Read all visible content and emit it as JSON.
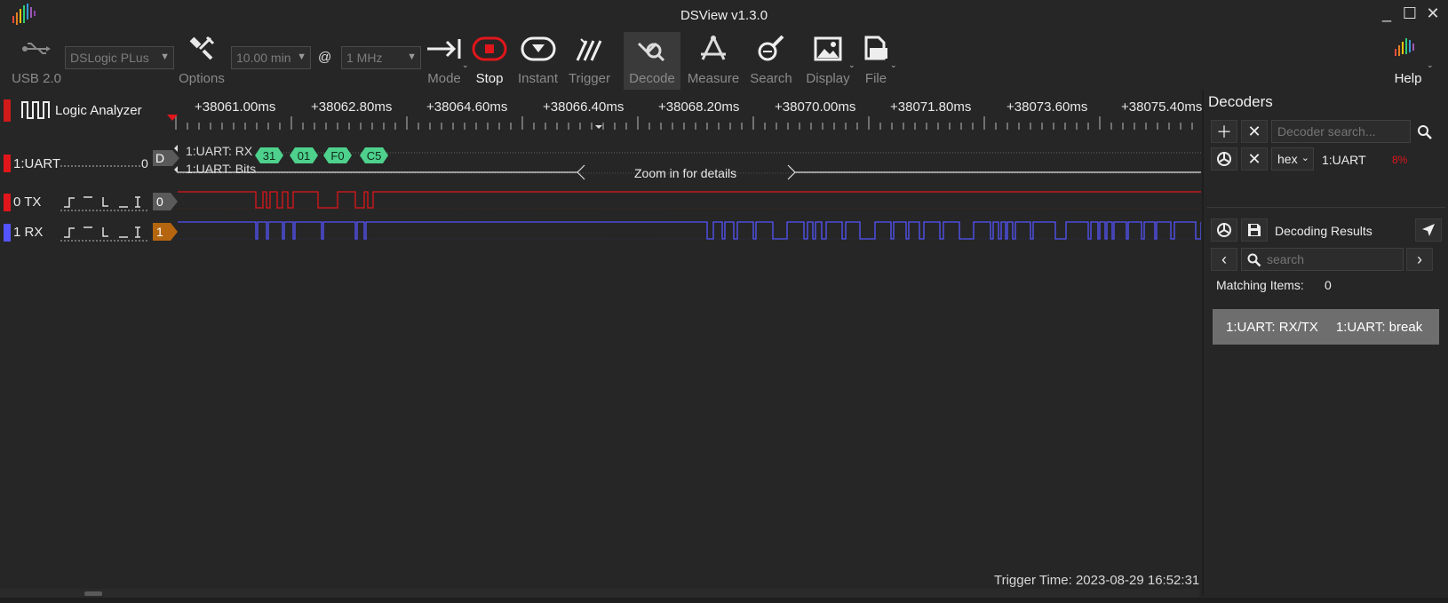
{
  "window": {
    "title": "DSView v1.3.0"
  },
  "toolbar": {
    "usb_label": "USB 2.0",
    "device": "DSLogic PLus",
    "options_label": "Options",
    "duration": "10.00 min",
    "at": "@",
    "rate": "1 MHz",
    "mode_label": "Mode",
    "stop_label": "Stop",
    "instant_label": "Instant",
    "trigger_label": "Trigger",
    "decode_label": "Decode",
    "measure_label": "Measure",
    "search_label": "Search",
    "display_label": "Display",
    "file_label": "File",
    "help_label": "Help"
  },
  "header": {
    "mode_title": "Logic Analyzer",
    "ruler": [
      "+38061.00ms",
      "+38062.80ms",
      "+38064.60ms",
      "+38066.40ms",
      "+38068.20ms",
      "+38070.00ms",
      "+38071.80ms",
      "+38073.60ms",
      "+38075.40ms"
    ]
  },
  "channels": {
    "uart": {
      "label": "1:UART",
      "index": "0",
      "tag": "D",
      "row1": "1:UART: RX",
      "row2": "1:UART: Bits",
      "bytes": [
        "31",
        "01",
        "F0",
        "C5"
      ],
      "zoom": "Zoom in for details"
    },
    "tx": {
      "label": "0 TX",
      "index": "0",
      "color": "#e0161b"
    },
    "rx": {
      "label": "1 RX",
      "index": "1",
      "color": "#5454ff"
    }
  },
  "decoders": {
    "title": "Decoders",
    "search_placeholder": "Decoder search...",
    "format": "hex",
    "name": "1:UART",
    "progress": "8%",
    "results_title": "Decoding Results",
    "results_search_placeholder": "search",
    "matching_label": "Matching Items:",
    "matching_count": "0",
    "result_col1": "1:UART: RX/TX",
    "result_col2": "1:UART: break"
  },
  "status": {
    "trigger_time": "Trigger Time: 2023-08-29 16:52:31"
  }
}
